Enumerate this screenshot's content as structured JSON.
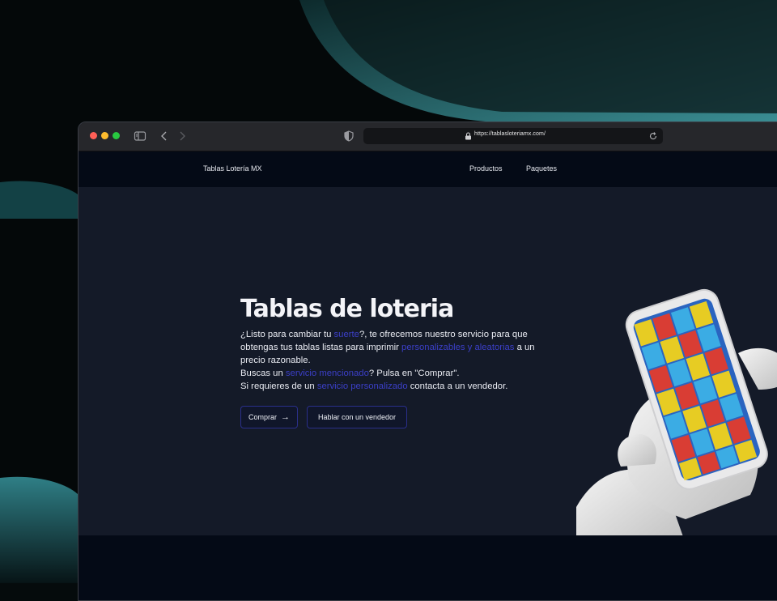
{
  "browser": {
    "url": "https://tablasloteriamx.com/"
  },
  "nav": {
    "brand": "Tablas Lotería MX",
    "links": [
      "Productos",
      "Paquetes"
    ]
  },
  "hero": {
    "title": "Tablas de loteria",
    "paragraph": {
      "line1_pre": "¿Listo para cambiar tu ",
      "line1_link": "suerte",
      "line1_post": "?, te ofrecemos nuestro servicio para que obtengas tus tablas listas para imprimir ",
      "line1_link2": "personalizables y aleatorias",
      "line1_end": " a un precio razonable.",
      "line2_pre": "Buscas un ",
      "line2_link": "servicio mencionado",
      "line2_post": "? Pulsa en \"Comprar\".",
      "line3_pre": "Si requieres de un ",
      "line3_link": "servicio personalizado",
      "line3_post": " contacta a un vendedor."
    },
    "buttons": {
      "buy": "Comprar",
      "sales": "Hablar con un vendedor"
    }
  },
  "icons": {
    "sidebar": "sidebar-icon",
    "back": "chevron-left-icon",
    "forward": "chevron-right-icon",
    "shield": "shield-icon",
    "lock": "lock-icon",
    "reload": "reload-icon",
    "arrow": "arrow-right-icon"
  },
  "colors": {
    "accent": "#3b3fc7",
    "hero_bg": "#141a28",
    "nav_bg": "#040a16"
  }
}
